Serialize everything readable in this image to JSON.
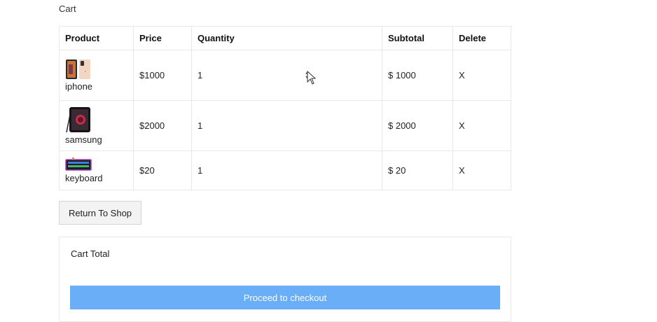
{
  "breadcrumb": "Cart",
  "table": {
    "headers": [
      "Product",
      "Price",
      "Quantity",
      "Subtotal",
      "Delete"
    ],
    "rows": [
      {
        "image_icon": "iphone-image",
        "name": "iphone",
        "price": "$1000",
        "quantity": "1",
        "subtotal": "$ 1000",
        "delete": "X"
      },
      {
        "image_icon": "samsung-phone-image",
        "name": "samsung",
        "price": "$2000",
        "quantity": "1",
        "subtotal": "$ 2000",
        "delete": "X"
      },
      {
        "image_icon": "keyboard-image",
        "name": "keyboard",
        "price": "$20",
        "quantity": "1",
        "subtotal": "$ 20",
        "delete": "X"
      }
    ]
  },
  "buttons": {
    "return_to_shop": "Return To Shop",
    "proceed_to_checkout": "Proceed to checkout"
  },
  "cart_total": {
    "title": "Cart Total"
  },
  "colors": {
    "checkout_button": "#6aaef8",
    "return_button_bg": "#f3f3f3",
    "border": "#e8e8e8"
  }
}
